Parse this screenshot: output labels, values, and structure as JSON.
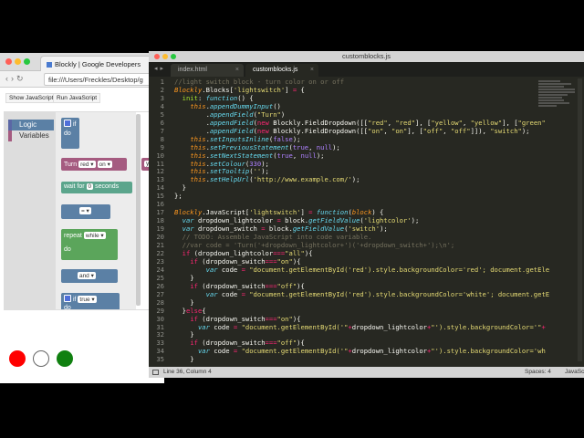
{
  "browser": {
    "tab_title": "Blockly | Google Developers",
    "url": "file:///Users/Freckles/Desktop/g",
    "buttons": [
      "Show JavaScript",
      "Run JavaScript"
    ],
    "categories": [
      "Logic",
      "Variables"
    ],
    "blocks": {
      "if": "if",
      "do": "do",
      "turn": "Turn",
      "red": "red",
      "on": "on",
      "ye": "yel",
      "wait": "wait for",
      "wait_num": "0",
      "wait_unit": "seconds",
      "eq": "=",
      "repeat": "repeat",
      "while": "while",
      "and": "and",
      "true": "true"
    },
    "circle_colors": [
      "#ff0000",
      "#ffffff",
      "#108010"
    ]
  },
  "editor": {
    "window_title": "customblocks.js",
    "tabs": [
      "index.html",
      "customblocks.js"
    ],
    "status_position": "Line 36, Column 4",
    "status_spaces": "Spaces: 4",
    "status_language": "JavaSc",
    "line_numbers": [
      "1",
      "2",
      "3",
      "4",
      "5",
      "6",
      "7",
      "8",
      "9",
      "10",
      "11",
      "12",
      "13",
      "14",
      "15",
      "16",
      "17",
      "18",
      "19",
      "20",
      "21",
      "22",
      "23",
      "24",
      "25",
      "26",
      "27",
      "28",
      "29",
      "30",
      "31",
      "32",
      "33",
      "34",
      "35"
    ]
  },
  "colors": {
    "editor_bg": "#272822",
    "logic_blocks": "#5b80a5",
    "text_blocks": "#a55b80",
    "loop_blocks": "#5ba55b",
    "accent_tab": "#f92672"
  }
}
